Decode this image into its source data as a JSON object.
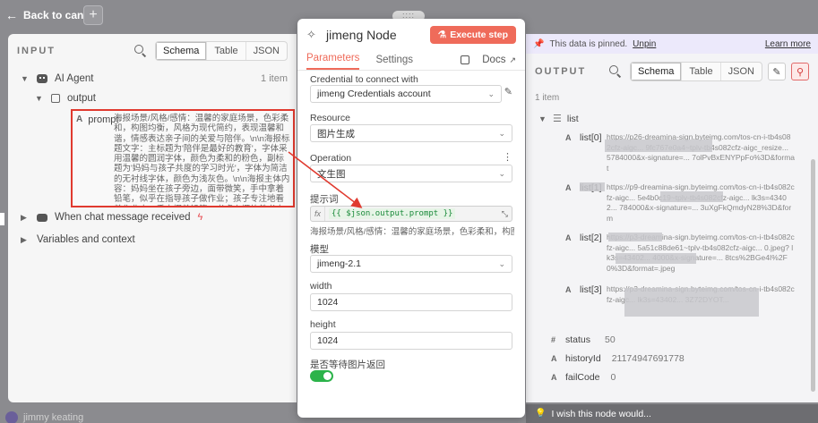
{
  "canvas": {
    "back_label": "Back to canvas",
    "grip": "::::",
    "user_name": "jimmy keating"
  },
  "input": {
    "title": "INPUT",
    "view_tabs": [
      "Schema",
      "Table",
      "JSON"
    ],
    "active_view": "Schema",
    "ai_agent": {
      "label": "AI Agent",
      "count": "1 item"
    },
    "output_label": "output",
    "prompt": {
      "type_badge": "A",
      "key": "prompt",
      "value": "海报场景/风格/感情：温馨的家庭场景，色彩柔和，构图均衡，风格为现代简约，表现温馨和谐，情感表达亲子间的关爱与陪伴。\\n\\n海报标题文字：主标题为'陪伴是最好的教育'，字体采用温馨的圆润字体，颜色为柔和的粉色，副标题为'妈妈与孩子共度的学习时光'，字体为简洁的无衬线字体，颜色为浅灰色。\\n\\n海报主体内容：妈妈坐在孩子旁边，面带微笑，手中拿着铅笔，似乎在指导孩子做作业；孩子专注地看着作业本，手中握着铅笔，书桌上摆放着书本和文具。\\n\\n海报背景：背景为温馨的家庭书房，书架上整齐排列着书籍，窗外是明媚的阳光，整体氛围温暖舒适，背景采用柔和的暖色调渲染。\\n\\n海报构图：画面以妈妈和孩子为中心对称，突出母子互动的温馨场景。\\n\\n海报风格：高级感，令人舒适，赏心悦目。"
    },
    "trigger": {
      "label": "When chat message received"
    },
    "variables": {
      "label": "Variables and context"
    }
  },
  "node": {
    "title": "jimeng Node",
    "execute_label": "Execute step",
    "tabs": [
      "Parameters",
      "Settings"
    ],
    "active_tab": "Parameters",
    "docs_label": "Docs",
    "credential": {
      "label": "Credential to connect with",
      "value": "jimeng Credentials account"
    },
    "resource": {
      "label": "Resource",
      "value": "图片生成"
    },
    "operation": {
      "label": "Operation",
      "value": "文生图"
    },
    "prompt": {
      "label": "提示词",
      "fx": "fx",
      "expression": "{{ $json.output.prompt }}",
      "preview": "海报场景/风格/感情：温馨的家庭场景，色彩柔和，构图均衡，..."
    },
    "model": {
      "label": "模型",
      "value": "jimeng-2.1"
    },
    "width": {
      "label": "width",
      "value": "1024"
    },
    "height": {
      "label": "height",
      "value": "1024"
    },
    "wait": {
      "label": "是否等待图片返回",
      "enabled": true
    }
  },
  "output": {
    "pinned_text": "This data is pinned.",
    "unpin_label": "Unpin",
    "learn_more": "Learn more",
    "title": "OUTPUT",
    "view_tabs": [
      "Schema",
      "Table",
      "JSON"
    ],
    "active_view": "Schema",
    "count": "1 item",
    "list_label": "list",
    "list_items": [
      {
        "key": "list[0]",
        "value": "https://p26-dreamina-sign.byteimg.com/tos-cn-i-tb4s082cfz-aigc... 9fc767e0a4~tplv-tb4s082cfz-aigc_resize... 5784000&x-signature=... 7olPvBxENYPpFo%3D&format"
      },
      {
        "key": "list[1]",
        "value": "https://p9-dreamina-sign.byteimg.com/tos-cn-i-tb4s082cfz-aigc... 5e4b0c19~tplv-tb4s082cfz-aigc... lk3s=43402... 784000&x-signature=... 3uXgFkQmdyN28%3D&form"
      },
      {
        "key": "list[2]",
        "value": "https://p3-dreamina-sign.byteimg.com/tos-cn-i-tb4s082cfz-aigc... 5a51c88de61~tplv-tb4s082cfz-aigc... 0.jpeg? lk3s=43402... 4000&x-signature=... 8tcs%2BGe4I%2F0%3D&format=.jpeg"
      },
      {
        "key": "list[3]",
        "value": "https://p3-dreamina-sign.byteimg.com/tos-cn-i-tb4s082cfz-aigc... lk3s=43402... 3Z72DYOT..."
      }
    ],
    "status": {
      "key": "status",
      "value": "50"
    },
    "history": {
      "key": "historyId",
      "value": "21174947691778"
    },
    "fail": {
      "key": "failCode",
      "value": "0"
    },
    "wish_label": "I wish this node would..."
  },
  "colors": {
    "accent": "#ef6b5a",
    "highlight_box": "#e03a2f",
    "pinned_bg": "#ece9fb",
    "toggle_on": "#2cb34a"
  }
}
